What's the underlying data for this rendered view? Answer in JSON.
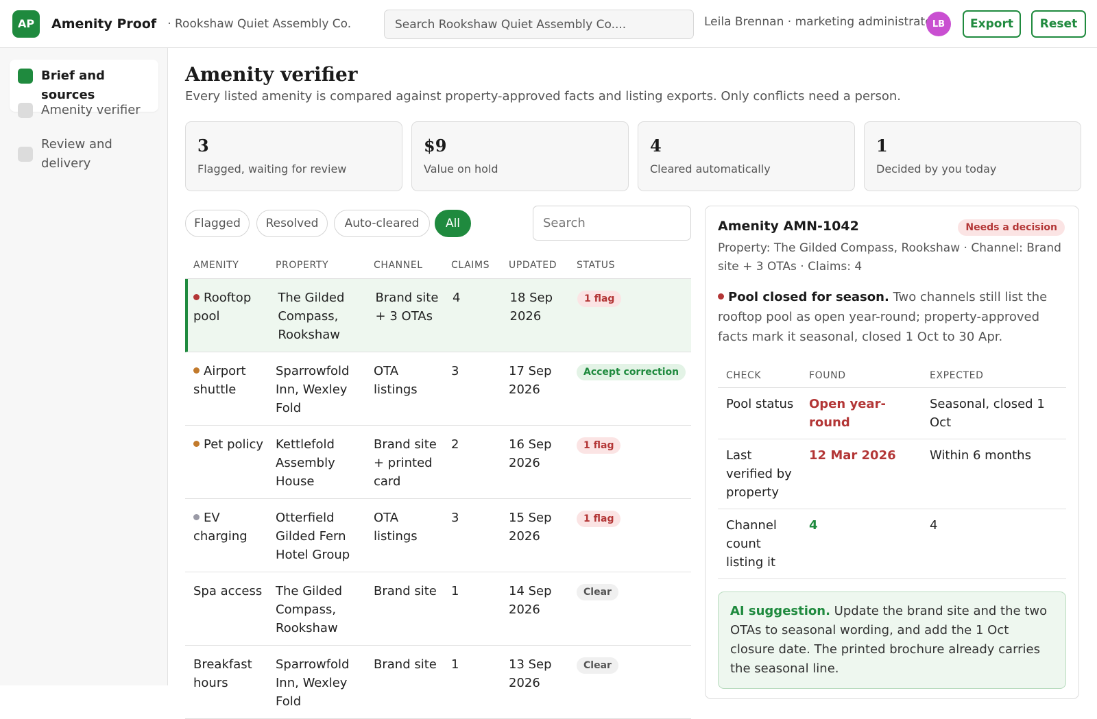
{
  "header": {
    "logo": "AP",
    "app_name": "Amenity Proof",
    "org": "· Rookshaw Quiet Assembly Co.",
    "search_placeholder": "Search Rookshaw Quiet Assembly Co....",
    "user": "Leila Brennan · marketing administrator",
    "avatar": "LB",
    "export_label": "Export",
    "reset_label": "Reset"
  },
  "sidebar": {
    "items": [
      {
        "label": "Brief and sources",
        "active": true
      },
      {
        "label": "Amenity verifier",
        "active": false
      },
      {
        "label": "Review and delivery",
        "active": false
      }
    ]
  },
  "main": {
    "title": "Amenity verifier",
    "subtitle": "Every listed amenity is compared against property-approved facts and listing exports. Only conflicts need a person."
  },
  "stats": [
    {
      "value": "3",
      "label": "Flagged, waiting for review"
    },
    {
      "value": "$9",
      "label": "Value on hold"
    },
    {
      "value": "4",
      "label": "Cleared automatically"
    },
    {
      "value": "1",
      "label": "Decided by you today"
    }
  ],
  "filters": {
    "chips": [
      "Flagged",
      "Resolved",
      "Auto-cleared",
      "All"
    ],
    "active": "All",
    "search_placeholder": "Search"
  },
  "table": {
    "columns": [
      "AMENITY",
      "PROPERTY",
      "CHANNEL",
      "CLAIMS",
      "UPDATED",
      "STATUS"
    ],
    "rows": [
      {
        "amenity": "Rooftop pool",
        "property": "The Gilded Compass, Rookshaw",
        "channel": "Brand site + 3 OTAs",
        "claims": "4",
        "updated": "18 Sep 2026",
        "status": "1 flag",
        "dot_color": "#b33636",
        "status_type": "flag"
      },
      {
        "amenity": "Airport shuttle",
        "property": "Sparrowfold Inn, Wexley Fold",
        "channel": "OTA listings",
        "claims": "3",
        "updated": "17 Sep 2026",
        "status": "Accept correction",
        "dot_color": "#c27a2c",
        "status_type": "accept"
      },
      {
        "amenity": "Pet policy",
        "property": "Kettlefold Assembly House",
        "channel": "Brand site + printed card",
        "claims": "2",
        "updated": "16 Sep 2026",
        "status": "1 flag",
        "dot_color": "#c27a2c",
        "status_type": "flag"
      },
      {
        "amenity": "EV charging",
        "property": "Otterfield Gilded Fern Hotel Group",
        "channel": "OTA listings",
        "claims": "3",
        "updated": "15 Sep 2026",
        "status": "1 flag",
        "dot_color": "#9a9aa6",
        "status_type": "flag"
      },
      {
        "amenity": "Spa access",
        "property": "The Gilded Compass, Rookshaw",
        "channel": "Brand site",
        "claims": "1",
        "updated": "14 Sep 2026",
        "status": "Clear",
        "dot_color": "",
        "status_type": "clear"
      },
      {
        "amenity": "Breakfast hours",
        "property": "Sparrowfold Inn, Wexley Fold",
        "channel": "Brand site",
        "claims": "1",
        "updated": "13 Sep 2026",
        "status": "Clear",
        "dot_color": "",
        "status_type": "clear"
      }
    ]
  },
  "detail": {
    "title": "Amenity AMN-1042",
    "badge": "Needs a decision",
    "meta": "Property: The Gilded Compass, Rookshaw · Channel: Brand site + 3 OTAs · Claims: 4",
    "finding_title": "Pool closed for season.",
    "finding_text": "Two channels still list the rooftop pool as open year-round; property-approved facts mark it seasonal, closed 1 Oct to 30 Apr.",
    "check_columns": [
      "CHECK",
      "FOUND",
      "EXPECTED"
    ],
    "checks": [
      {
        "check": "Pool status",
        "found": "Open year-round",
        "expected": "Seasonal, closed 1 Oct",
        "found_color": "#b33636"
      },
      {
        "check": "Last verified by property",
        "found": "12 Mar 2026",
        "expected": "Within 6 months",
        "found_color": "#b33636"
      },
      {
        "check": "Channel count listing it",
        "found": "4",
        "expected": "4",
        "found_color": "#1f8a3e"
      }
    ],
    "ai_label": "AI suggestion.",
    "ai_text": "Update the brand site and the two OTAs to seasonal wording, and add the 1 Oct closure date. The printed brochure already carries the seasonal line."
  },
  "colors": {
    "accent": "#1f8a3e",
    "danger": "#b33636",
    "flag_bg": "#fbe4e4",
    "accept_bg": "#e3f3e6",
    "clear_bg": "#f0f0f0"
  }
}
